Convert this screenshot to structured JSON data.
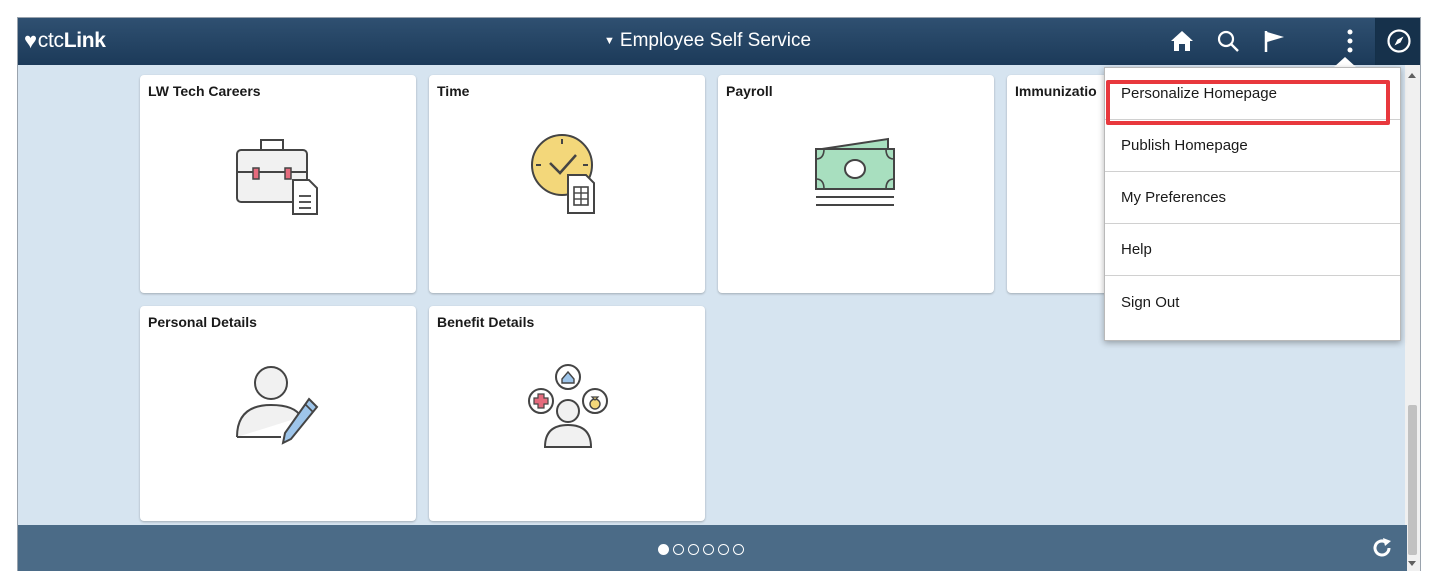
{
  "banner": {
    "logo_prefix": "ctc",
    "logo_suffix": "Link",
    "title": "Employee Self Service",
    "icons": [
      "home-icon",
      "search-icon",
      "flag-icon",
      "more-vertical-icon",
      "navbar-compass-icon"
    ]
  },
  "tiles": [
    {
      "title": "LW Tech Careers",
      "icon": "briefcase-document-icon"
    },
    {
      "title": "Time",
      "icon": "clock-timesheet-icon"
    },
    {
      "title": "Payroll",
      "icon": "money-icon"
    },
    {
      "title": "Immunizatio",
      "icon": ""
    },
    {
      "title": "Personal Details",
      "icon": "person-edit-icon"
    },
    {
      "title": "Benefit Details",
      "icon": "benefits-person-icon"
    }
  ],
  "actions_menu": {
    "items": [
      "Personalize Homepage",
      "Publish Homepage",
      "My Preferences",
      "Help",
      "Sign Out"
    ],
    "highlighted_item": "Personalize Homepage"
  },
  "footer": {
    "page_count": 6,
    "active_page": 1
  },
  "colors": {
    "banner": "#1c3a59",
    "content_bg": "#d6e4f0",
    "footer": "#4b6b87",
    "highlight": "#e8383d"
  }
}
